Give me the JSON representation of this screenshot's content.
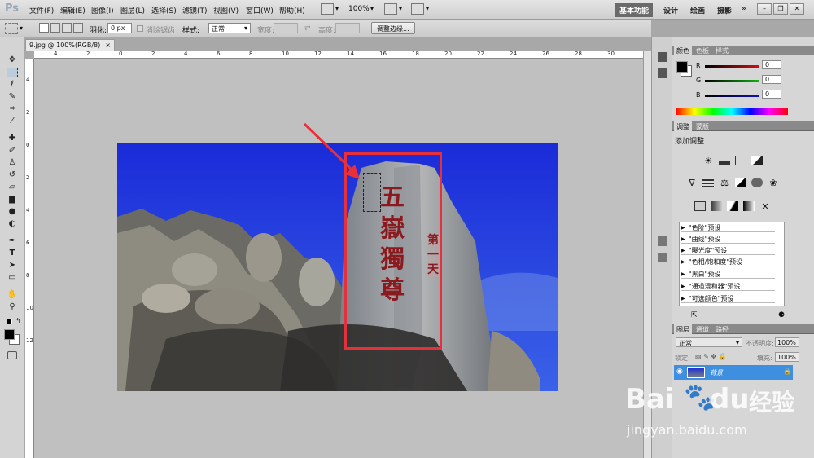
{
  "app": {
    "logo": "Ps"
  },
  "menu": [
    "文件(F)",
    "编辑(E)",
    "图像(I)",
    "图层(L)",
    "选择(S)",
    "滤镜(T)",
    "视图(V)",
    "窗口(W)",
    "帮助(H)"
  ],
  "appbar": {
    "zoom": "100%"
  },
  "workspaces": {
    "active": "基本功能",
    "items": [
      "设计",
      "绘画",
      "摄影"
    ],
    "more": "»"
  },
  "options": {
    "feather_label": "羽化:",
    "feather_value": "0 px",
    "antialias_label": "消除锯齿",
    "style_label": "样式:",
    "style_value": "正常",
    "width_label": "宽度:",
    "height_label": "高度:",
    "refine_button": "调整边缘..."
  },
  "document": {
    "tab_title": "9.jpg @ 100%(RGB/8)",
    "close": "×"
  },
  "rulers": {
    "h": [
      "4",
      "2",
      "0",
      "2",
      "4",
      "6",
      "8",
      "10",
      "12",
      "14",
      "16",
      "18",
      "20",
      "22",
      "24",
      "26",
      "28",
      "30"
    ],
    "v": [
      "4",
      "2",
      "0",
      "2",
      "4",
      "6",
      "8",
      "10",
      "12"
    ]
  },
  "color_panel": {
    "tabs": [
      "颜色",
      "色板",
      "样式"
    ],
    "channels": [
      {
        "label": "R",
        "value": "0",
        "color": "#d01010"
      },
      {
        "label": "G",
        "value": "0",
        "color": "#10b010"
      },
      {
        "label": "B",
        "value": "0",
        "color": "#1010c0"
      }
    ]
  },
  "adjust_panel": {
    "tabs": [
      "调整",
      "蒙版"
    ],
    "title": "添加调整",
    "presets": [
      "\"色阶\"预设",
      "\"曲线\"预设",
      "\"曝光度\"预设",
      "\"色相/饱和度\"预设",
      "\"黑白\"预设",
      "\"通道混和器\"预设",
      "\"可选颜色\"预设"
    ]
  },
  "layers_panel": {
    "tabs": [
      "图层",
      "通道",
      "路径"
    ],
    "blend": "正常",
    "opacity_label": "不透明度:",
    "opacity": "100%",
    "lock_label": "锁定:",
    "fill_label": "填充:",
    "fill": "100%",
    "layers": [
      {
        "name": "背景",
        "locked": true,
        "visible": true
      }
    ]
  },
  "image": {
    "text_main": "五嶽獨尊",
    "text_side": "第一天"
  },
  "watermark": {
    "brand": "Bai",
    "brand2": "du",
    "cn": "经验",
    "url": "jingyan.baidu.com"
  }
}
